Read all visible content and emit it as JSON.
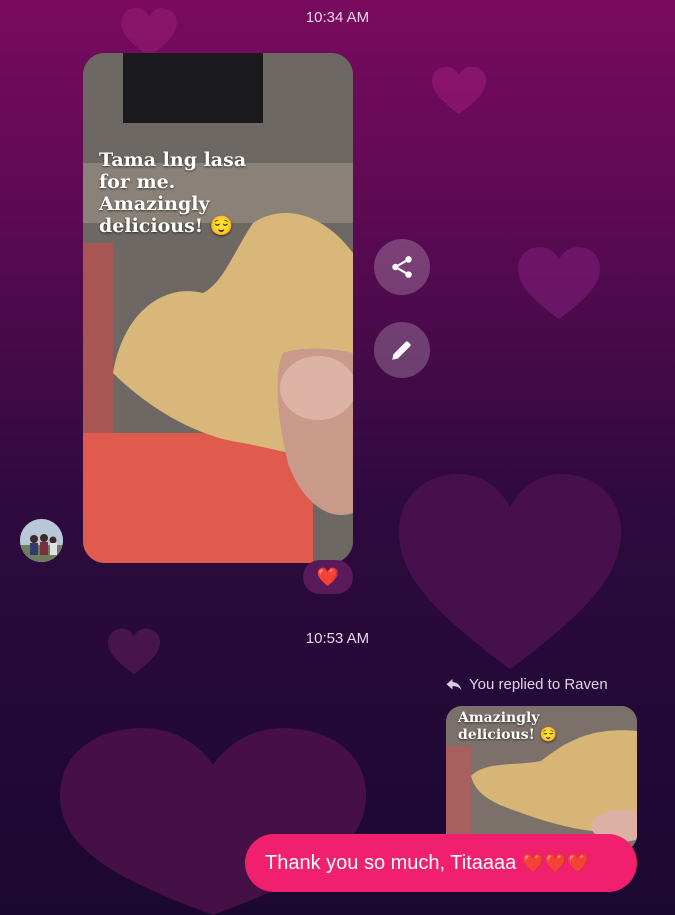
{
  "conversation": {
    "timestamps": [
      "10:34 AM",
      "10:53 AM"
    ],
    "media_message": {
      "caption_lines": [
        "Tama lng lasa",
        "for me.",
        "Amazingly",
        "delicious! 😌"
      ],
      "reaction": "❤️"
    },
    "actions": {
      "share_icon": "share-icon",
      "edit_icon": "pencil-icon"
    },
    "reply": {
      "note": "You replied to Raven",
      "quoted_caption_lines": [
        "Amazingly",
        "delicious! 😌"
      ],
      "message": "Thank you so much, Titaaaa",
      "message_hearts": "❤️❤️❤️"
    },
    "colors": {
      "bubble": "#f0206e",
      "background_top": "#7a0a5e",
      "background_bottom": "#1b0830"
    }
  }
}
